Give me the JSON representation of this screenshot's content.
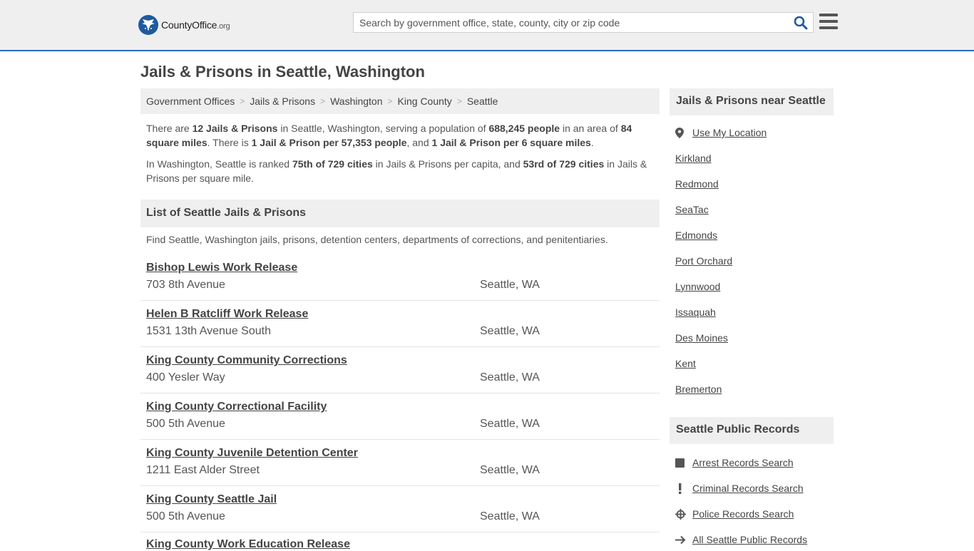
{
  "header": {
    "logo_main": "CountyOffice",
    "logo_tld": ".org",
    "search_placeholder": "Search by government office, state, county, city or zip code"
  },
  "page": {
    "title": "Jails & Prisons in Seattle, Washington"
  },
  "breadcrumb": [
    "Government Offices",
    "Jails & Prisons",
    "Washington",
    "King County",
    "Seattle"
  ],
  "intro": {
    "p1": [
      {
        "t": "There are ",
        "b": false
      },
      {
        "t": "12 Jails & Prisons",
        "b": true
      },
      {
        "t": " in Seattle, Washington, serving a population of ",
        "b": false
      },
      {
        "t": "688,245 people",
        "b": true
      },
      {
        "t": " in an area of ",
        "b": false
      },
      {
        "t": "84 square miles",
        "b": true
      },
      {
        "t": ". There is ",
        "b": false
      },
      {
        "t": "1 Jail & Prison per 57,353 people",
        "b": true
      },
      {
        "t": ", and ",
        "b": false
      },
      {
        "t": "1 Jail & Prison per 6 square miles",
        "b": true
      },
      {
        "t": ".",
        "b": false
      }
    ],
    "p2": [
      {
        "t": "In Washington, Seattle is ranked ",
        "b": false
      },
      {
        "t": "75th of 729 cities",
        "b": true
      },
      {
        "t": " in Jails & Prisons per capita, and ",
        "b": false
      },
      {
        "t": "53rd of 729 cities",
        "b": true
      },
      {
        "t": " in Jails & Prisons per square mile.",
        "b": false
      }
    ]
  },
  "list": {
    "heading": "List of Seattle Jails & Prisons",
    "description": "Find Seattle, Washington jails, prisons, detention centers, departments of corrections, and penitentiaries.",
    "items": [
      {
        "name": "Bishop Lewis Work Release",
        "address": "703 8th Avenue",
        "city": "Seattle, WA"
      },
      {
        "name": "Helen B Ratcliff Work Release",
        "address": "1531 13th Avenue South",
        "city": "Seattle, WA"
      },
      {
        "name": "King County Community Corrections",
        "address": "400 Yesler Way",
        "city": "Seattle, WA"
      },
      {
        "name": "King County Correctional Facility",
        "address": "500 5th Avenue",
        "city": "Seattle, WA"
      },
      {
        "name": "King County Juvenile Detention Center",
        "address": "1211 East Alder Street",
        "city": "Seattle, WA"
      },
      {
        "name": "King County Seattle Jail",
        "address": "500 5th Avenue",
        "city": "Seattle, WA"
      },
      {
        "name": "King County Work Education Release",
        "address": "",
        "city": ""
      }
    ]
  },
  "sidebar": {
    "nearby_heading": "Jails & Prisons near Seattle",
    "use_location": "Use My Location",
    "nearby": [
      "Kirkland",
      "Redmond",
      "SeaTac",
      "Edmonds",
      "Port Orchard",
      "Lynnwood",
      "Issaquah",
      "Des Moines",
      "Kent",
      "Bremerton"
    ],
    "records_heading": "Seattle Public Records",
    "records": [
      {
        "label": "Arrest Records Search",
        "icon": "square-icon"
      },
      {
        "label": "Criminal Records Search",
        "icon": "exclamation-icon"
      },
      {
        "label": "Police Records Search",
        "icon": "crosshair-icon"
      },
      {
        "label": "All Seattle Public Records",
        "icon": "arrow-right-icon"
      }
    ]
  },
  "colors": {
    "accent": "#2a6eb4",
    "header_bg": "#efefef",
    "text": "#444444"
  }
}
